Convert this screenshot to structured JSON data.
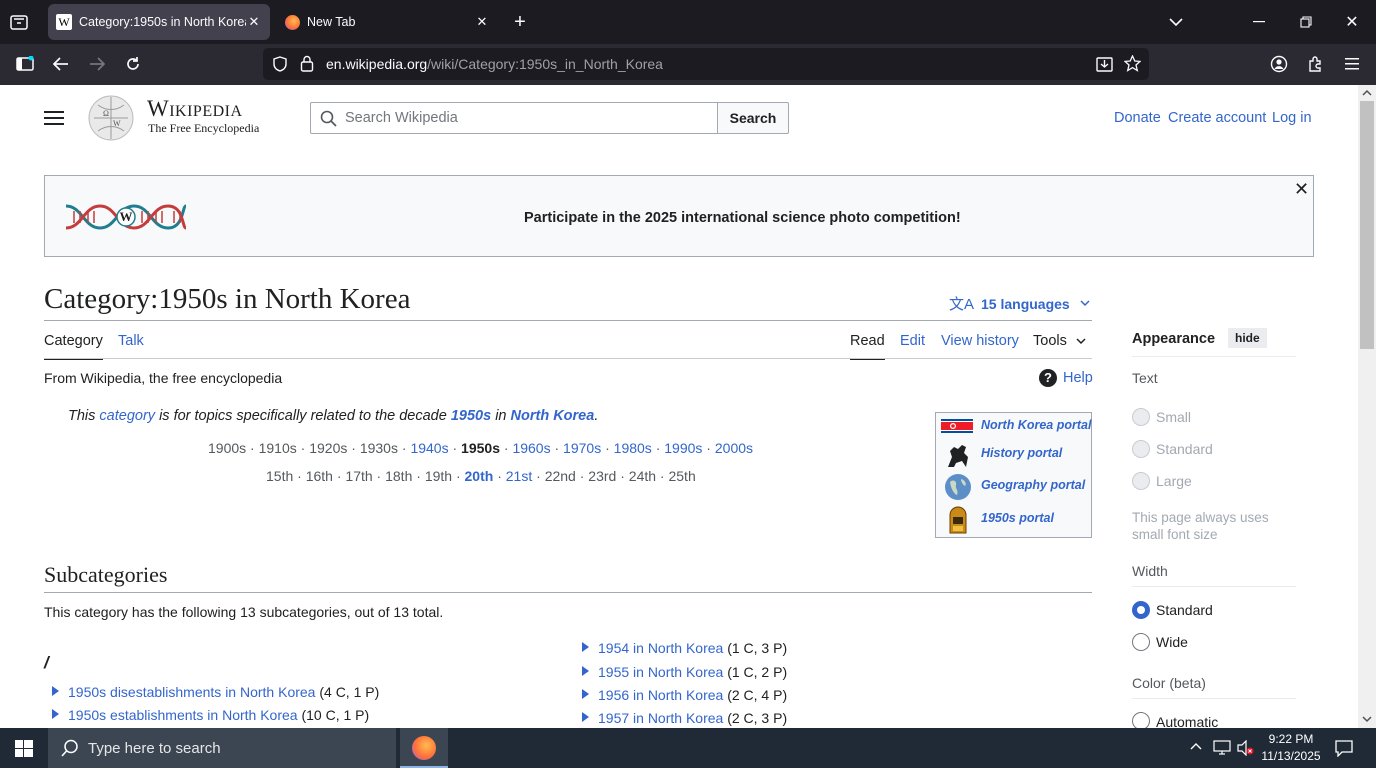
{
  "browser": {
    "tabs": [
      {
        "title": "Category:1950s in North Korea",
        "active": true
      },
      {
        "title": "New Tab",
        "active": false
      }
    ],
    "url_domain": "en.wikipedia.org",
    "url_path": "/wiki/Category:1950s_in_North_Korea"
  },
  "header": {
    "wordmark": "Wikipedia",
    "tagline": "The Free Encyclopedia",
    "search_placeholder": "Search Wikipedia",
    "search_button": "Search",
    "links": [
      "Donate",
      "Create account",
      "Log in"
    ]
  },
  "banner": {
    "text": "Participate in the 2025 international science photo competition!",
    "logo_text": "W"
  },
  "page": {
    "title": "Category:1950s in North Korea",
    "languages": "15 languages",
    "tabs_left": [
      "Category",
      "Talk"
    ],
    "tabs_right": [
      "Read",
      "Edit",
      "View history",
      "Tools"
    ],
    "from": "From Wikipedia, the free encyclopedia",
    "help": "Help",
    "intro": {
      "p1": "This ",
      "link1": "category",
      "p2": " is for topics specifically related to the decade ",
      "link2": "1950s",
      "p3": " in ",
      "link3": "North Korea",
      "p4": "."
    },
    "decades": [
      {
        "t": "1900s",
        "link": false
      },
      {
        "t": "1910s",
        "link": false
      },
      {
        "t": "1920s",
        "link": false
      },
      {
        "t": "1930s",
        "link": false
      },
      {
        "t": "1940s",
        "link": true
      },
      {
        "t": "1950s",
        "link": false,
        "bold": true
      },
      {
        "t": "1960s",
        "link": true
      },
      {
        "t": "1970s",
        "link": true
      },
      {
        "t": "1980s",
        "link": true
      },
      {
        "t": "1990s",
        "link": true
      },
      {
        "t": "2000s",
        "link": true
      }
    ],
    "centuries": [
      {
        "t": "15th",
        "link": false
      },
      {
        "t": "16th",
        "link": false
      },
      {
        "t": "17th",
        "link": false
      },
      {
        "t": "18th",
        "link": false
      },
      {
        "t": "19th",
        "link": false
      },
      {
        "t": "20th",
        "link": true,
        "bold": true
      },
      {
        "t": "21st",
        "link": true
      },
      {
        "t": "22nd",
        "link": false
      },
      {
        "t": "23rd",
        "link": false
      },
      {
        "t": "24th",
        "link": false
      },
      {
        "t": "25th",
        "link": false
      }
    ],
    "portals": [
      "North Korea portal",
      "History portal",
      "Geography portal",
      "1950s portal"
    ],
    "subcategories_heading": "Subcategories",
    "subcategories_intro": "This category has the following 13 subcategories, out of 13 total.",
    "group_letter": "/",
    "left_items": [
      {
        "name": "1950s disestablishments in North Korea",
        "count": "(4 C, 1 P)"
      },
      {
        "name": "1950s establishments in North Korea",
        "count": "(10 C, 1 P)"
      }
    ],
    "right_items": [
      {
        "name": "1954 in North Korea",
        "count": "(1 C, 3 P)"
      },
      {
        "name": "1955 in North Korea",
        "count": "(1 C, 2 P)"
      },
      {
        "name": "1956 in North Korea",
        "count": "(2 C, 4 P)"
      },
      {
        "name": "1957 in North Korea",
        "count": "(2 C, 3 P)"
      }
    ]
  },
  "appearance": {
    "title": "Appearance",
    "hide": "hide",
    "text_label": "Text",
    "text_options": [
      "Small",
      "Standard",
      "Large"
    ],
    "text_note": "This page always uses small font size",
    "width_label": "Width",
    "width_options": [
      "Standard",
      "Wide"
    ],
    "width_selected": "Standard",
    "color_label": "Color (beta)",
    "color_options": [
      "Automatic"
    ]
  },
  "taskbar": {
    "search_placeholder": "Type here to search",
    "time": "9:22 PM",
    "date": "11/13/2025"
  }
}
